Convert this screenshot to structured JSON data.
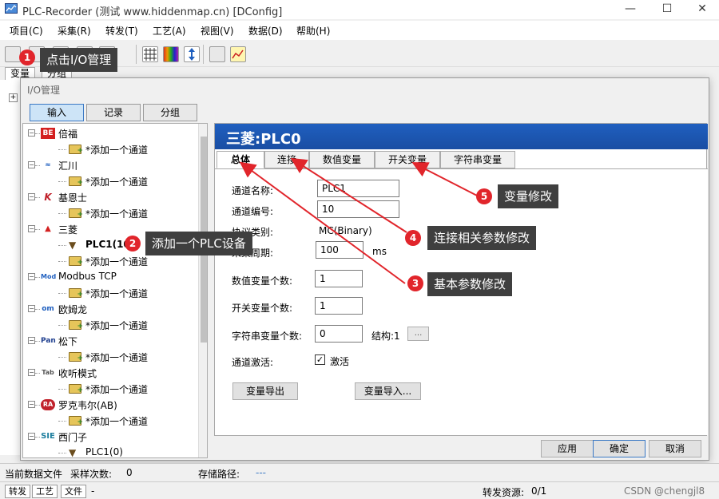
{
  "window": {
    "title": "PLC-Recorder (测试 www.hiddenmap.cn) [DConfig]",
    "controls": [
      "—",
      "☐",
      "✕"
    ]
  },
  "menu": [
    "项目(C)",
    "采集(R)",
    "转发(T)",
    "工艺(A)",
    "视图(V)",
    "数据(D)",
    "帮助(H)"
  ],
  "left_tabs": [
    "变量",
    "分组"
  ],
  "dialog": {
    "title": "I/O管理",
    "tabs": [
      "输入",
      "记录",
      "分组"
    ]
  },
  "tree": [
    {
      "logo": "BE",
      "logo_color": "#d32020",
      "label": "倍福",
      "child": "*添加一个通道"
    },
    {
      "logo": "≈",
      "logo_color": "#1f5fbf",
      "label": "汇川",
      "child": "*添加一个通道"
    },
    {
      "logo": "K",
      "logo_color": "#c0202a",
      "label": "基恩士",
      "child": "*添加一个通道"
    },
    {
      "logo": "▲",
      "logo_color": "#d32020",
      "label": "三菱",
      "children": [
        "PLC1(10)",
        "*添加一个通道"
      ]
    },
    {
      "logo": "Mod",
      "logo_color": "#1f5fbf",
      "label": "Modbus TCP",
      "child": "*添加一个通道"
    },
    {
      "logo": "om",
      "logo_color": "#1f5fbf",
      "label": "欧姆龙",
      "child": "*添加一个通道"
    },
    {
      "logo": "Pan",
      "logo_color": "#1f3f8f",
      "label": "松下",
      "child": "*添加一个通道"
    },
    {
      "logo": "Tab",
      "logo_color": "#555555",
      "label": "收听模式",
      "child": "*添加一个通道"
    },
    {
      "logo": "RA",
      "logo_color": "#c0202a",
      "label": "罗克韦尔(AB)",
      "child": "*添加一个通道"
    },
    {
      "logo": "SIE",
      "logo_color": "#1f7f9f",
      "label": "西门子",
      "child": "PLC1(0)"
    }
  ],
  "panel": {
    "header": "三菱:PLC0",
    "tabs": [
      "总体",
      "连接",
      "数值变量",
      "开关变量",
      "字符串变量"
    ],
    "fields": {
      "channel_name_label": "通道名称:",
      "channel_name_value": "PLC1",
      "channel_no_label": "通道编号:",
      "channel_no_value": "10",
      "protocol_label": "协议类别:",
      "protocol_value": "MC(Binary)",
      "period_label": "采集周期:",
      "period_value": "100",
      "period_unit": "ms",
      "num_var_label": "数值变量个数:",
      "num_var_value": "1",
      "switch_var_label": "开关变量个数:",
      "switch_var_value": "1",
      "string_var_label": "字符串变量个数:",
      "string_var_value": "0",
      "struct_label": "结构:1",
      "struct_btn": "...",
      "activate_label": "通道激活:",
      "activate_check": "激活",
      "export_btn": "变量导出",
      "import_btn": "变量导入..."
    }
  },
  "footer_buttons": [
    "应用",
    "确定",
    "取消"
  ],
  "annotations": [
    {
      "n": "1",
      "text": "点击I/O管理"
    },
    {
      "n": "2",
      "text": "添加一个PLC设备"
    },
    {
      "n": "3",
      "text": "基本参数修改"
    },
    {
      "n": "4",
      "text": "连接相关参数修改"
    },
    {
      "n": "5",
      "text": "变量修改"
    }
  ],
  "status": {
    "data_file": "当前数据文件",
    "sample_count_label": "采样次数:",
    "sample_count": "0",
    "storage_label": "存储路径:",
    "storage_value": "---",
    "tab1": "转发",
    "tab2": "工艺",
    "tab3": "文件",
    "tab3_value": "-",
    "forward_label": "转发资源:",
    "forward_value": "0/1",
    "watermark": "CSDN @chengjl8"
  },
  "colors": {
    "accent": "#1f5fbf",
    "badge": "#e1252b",
    "callout_bg": "#3f3f3f"
  }
}
